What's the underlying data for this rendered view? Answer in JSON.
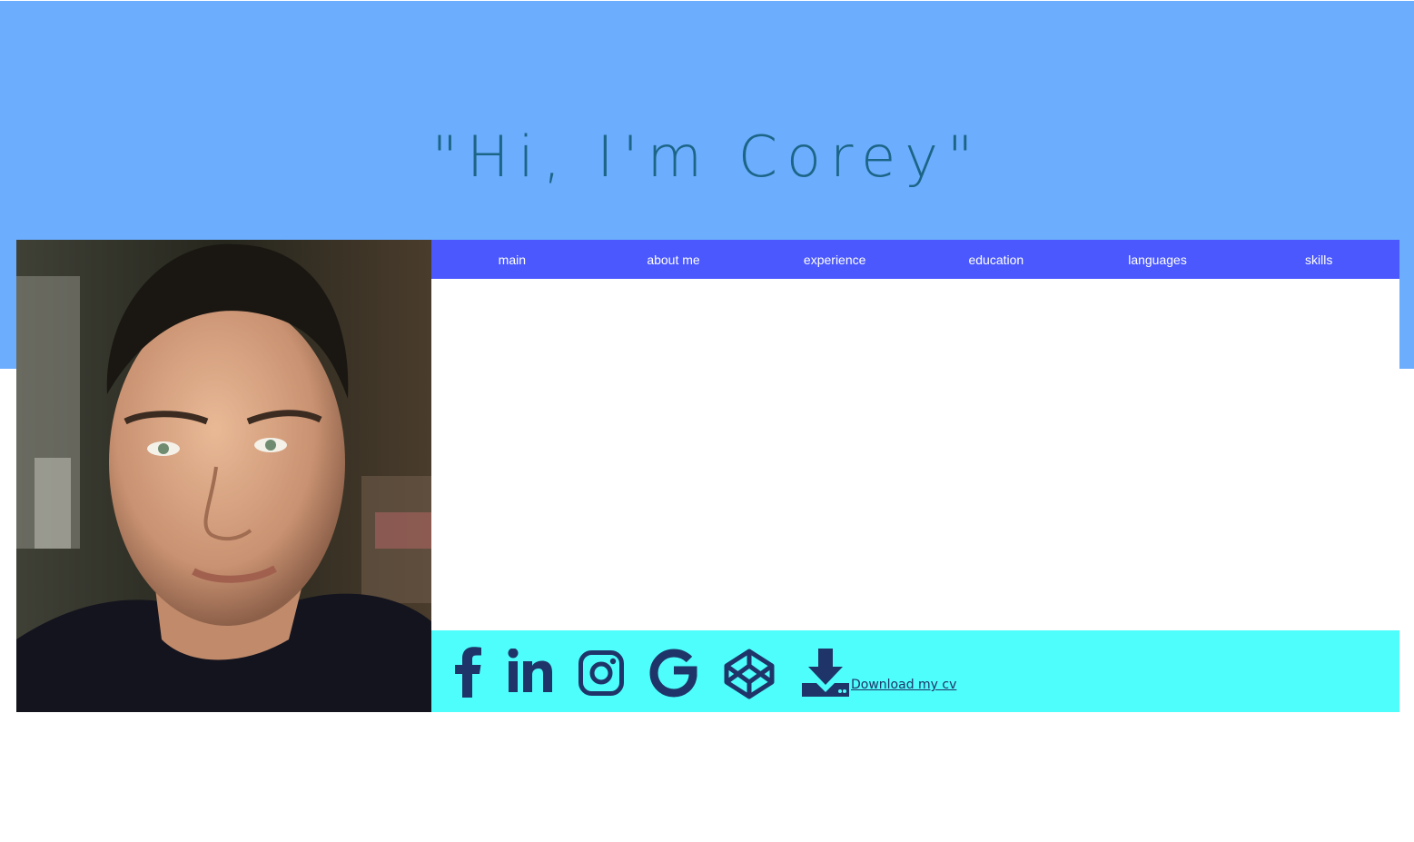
{
  "hero": {
    "title": "\"Hi, I'm Corey\""
  },
  "colors": {
    "hero_background": "#6cadfd",
    "title_text": "#1d6587",
    "nav_background": "#4a58fe",
    "nav_text": "#ffffff",
    "footer_background": "#4efefc",
    "icon_color": "#1f3569"
  },
  "nav": {
    "items": [
      {
        "label": "main"
      },
      {
        "label": "about me"
      },
      {
        "label": "experience"
      },
      {
        "label": "education"
      },
      {
        "label": "languages"
      },
      {
        "label": "skills"
      }
    ]
  },
  "social": {
    "icons": [
      "facebook-icon",
      "linkedin-icon",
      "instagram-icon",
      "google-icon",
      "codepen-icon",
      "download-icon"
    ],
    "cv_link": "Download my cv"
  }
}
